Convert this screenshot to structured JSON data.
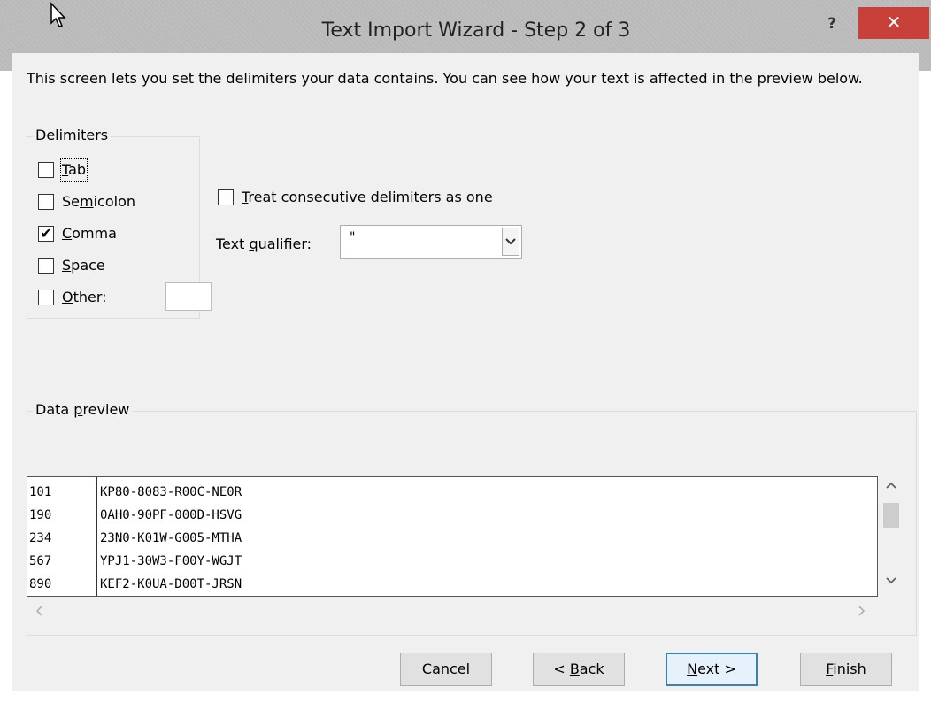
{
  "window": {
    "title": "Text Import Wizard - Step 2 of 3",
    "help_label": "?",
    "close_label": "✕",
    "accent_close": "#c7403a"
  },
  "description": "This screen lets you set the delimiters your data contains.  You can see how your text is affected in the preview below.",
  "delimiters": {
    "legend": "Delimiters",
    "tab": {
      "pre": "",
      "key": "T",
      "post": "ab",
      "checked": false
    },
    "semicolon": {
      "pre": "Se",
      "key": "m",
      "post": "icolon",
      "checked": false
    },
    "comma": {
      "pre": "",
      "key": "C",
      "post": "omma",
      "checked": true
    },
    "space": {
      "pre": "",
      "key": "S",
      "post": "pace",
      "checked": false
    },
    "other": {
      "pre": "",
      "key": "O",
      "post": "ther:",
      "checked": false,
      "value": ""
    }
  },
  "options": {
    "consecutive": {
      "pre": "",
      "key": "T",
      "post": "reat consecutive delimiters as one",
      "checked": false
    },
    "qualifier": {
      "pre": "Text ",
      "key": "q",
      "post": "ualifier:",
      "value": "\""
    }
  },
  "preview": {
    "legend_pre": "Data ",
    "legend_key": "p",
    "legend_post": "review",
    "rows": [
      {
        "c1": "101",
        "c2": "KP80-8083-R00C-NE0R"
      },
      {
        "c1": "190",
        "c2": "0AH0-90PF-000D-HSVG"
      },
      {
        "c1": "234",
        "c2": "23N0-K01W-G005-MTHA"
      },
      {
        "c1": "567",
        "c2": "YPJ1-30W3-F00Y-WGJT"
      },
      {
        "c1": "890",
        "c2": "KEF2-K0UA-D00T-JRSN"
      }
    ]
  },
  "buttons": {
    "cancel": "Cancel",
    "back": {
      "pre": "< ",
      "key": "B",
      "post": "ack"
    },
    "next": {
      "pre": "",
      "key": "N",
      "post": "ext >"
    },
    "finish": {
      "pre": "",
      "key": "F",
      "post": "inish"
    }
  }
}
